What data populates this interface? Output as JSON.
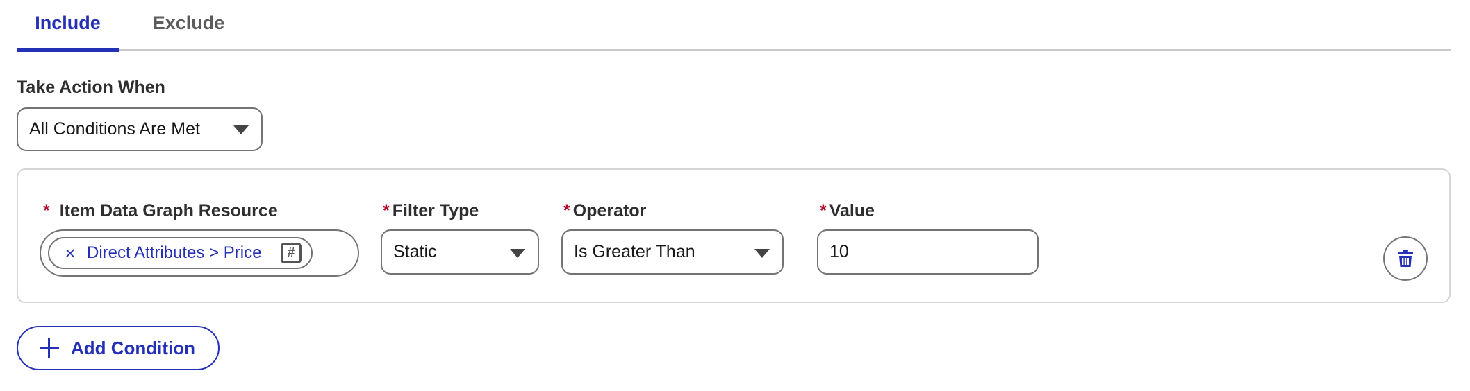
{
  "tabs": {
    "include": "Include",
    "exclude": "Exclude",
    "active": "Include"
  },
  "action": {
    "label": "Take Action When",
    "selected": "All Conditions Are Met"
  },
  "condition": {
    "required_marker": "*",
    "resource_label": "Item Data Graph Resource",
    "resource_pill": {
      "remove_icon": "×",
      "text": "Direct Attributes > Price",
      "type_icon": "#"
    },
    "filter_type_label": "Filter Type",
    "filter_type_value": "Static",
    "operator_label": "Operator",
    "operator_value": "Is Greater Than",
    "value_label": "Value",
    "value": "10"
  },
  "add_condition": {
    "label": "Add Condition"
  },
  "colors": {
    "accent": "#2430b5",
    "required": "#b3072c",
    "border": "#747474",
    "divider": "#c9c9c9"
  },
  "icons": {
    "dropdown": "chevron-down-icon",
    "delete": "trash-icon",
    "add": "plus-icon",
    "remove": "close-icon",
    "number_type": "hash-icon"
  }
}
